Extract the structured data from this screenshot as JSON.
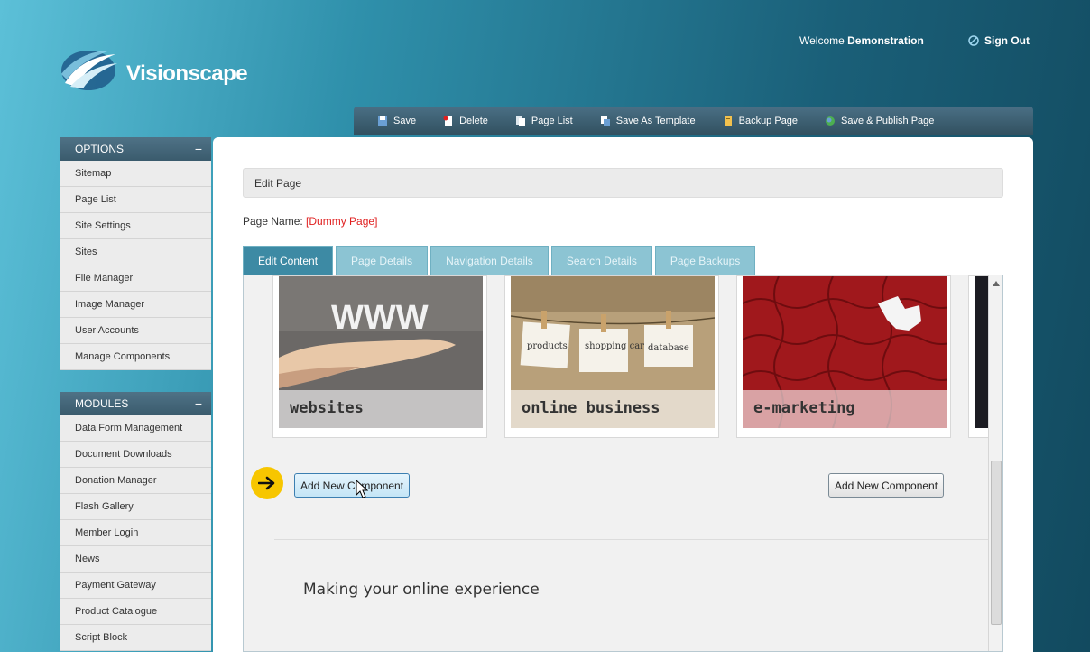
{
  "header": {
    "brand": "Visionscape",
    "welcome_prefix": "Welcome",
    "user": "Demonstration",
    "signout": "Sign Out"
  },
  "toolbar": [
    {
      "label": "Save",
      "icon": "save-icon"
    },
    {
      "label": "Delete",
      "icon": "delete-icon"
    },
    {
      "label": "Page List",
      "icon": "page-list-icon"
    },
    {
      "label": "Save As Template",
      "icon": "template-icon"
    },
    {
      "label": "Backup Page",
      "icon": "backup-icon"
    },
    {
      "label": "Save & Publish Page",
      "icon": "publish-icon"
    }
  ],
  "sidebar": {
    "options_title": "OPTIONS",
    "options": [
      "Sitemap",
      "Page List",
      "Site Settings",
      "Sites",
      "File Manager",
      "Image Manager",
      "User Accounts",
      "Manage Components"
    ],
    "modules_title": "MODULES",
    "modules": [
      "Data Form Management",
      "Document Downloads",
      "Donation Manager",
      "Flash Gallery",
      "Member Login",
      "News",
      "Payment Gateway",
      "Product Catalogue",
      "Script Block"
    ],
    "collapse_symbol": "−"
  },
  "main": {
    "edit_title": "Edit Page",
    "page_name_label": "Page Name:",
    "page_name_value": "[Dummy Page]",
    "tabs": [
      "Edit Content",
      "Page Details",
      "Navigation Details",
      "Search Details",
      "Page Backups"
    ],
    "panels": [
      "websites",
      "online business",
      "e-marketing"
    ],
    "www_text": "WWW",
    "notes": [
      "products",
      "shopping cart",
      "database"
    ],
    "add_left": "Add New Component",
    "add_right": "Add New Component",
    "tagline": "Making your online experience"
  },
  "colors": {
    "accent": "#3d8aa4",
    "highlight": "#f7c600",
    "name_red": "#e02020"
  }
}
